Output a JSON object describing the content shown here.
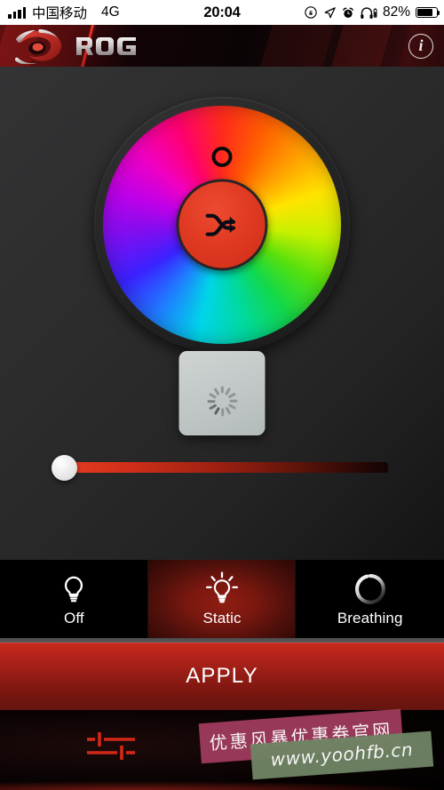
{
  "statusbar": {
    "carrier": "中国移动",
    "network": "4G",
    "time": "20:04",
    "battery_percent": "82%",
    "icons": [
      "signal-bars-icon",
      "rotation-lock-icon",
      "location-arrow-icon",
      "alarm-clock-icon",
      "headphones-battery-icon",
      "battery-icon"
    ]
  },
  "header": {
    "brand": "ROG",
    "logo_icon": "rog-eye-logo",
    "info_icon": "info-icon",
    "info_label": "i"
  },
  "main": {
    "color_wheel": {
      "name": "color-wheel",
      "selected_hue_deg": 0,
      "cursor_icon": "hue-selector-ring",
      "center_button_icon": "shuffle-icon",
      "center_button_color": "#e03a22"
    },
    "brightness_popup": {
      "name": "brightness-popup",
      "icon": "loading-spinner-icon",
      "background": "#c3c9c8"
    },
    "brightness_slider": {
      "name": "brightness-slider",
      "value_percent": 0,
      "track_start_color": "#e23a20",
      "track_end_color": "#140404",
      "thumb_color": "#ffffff"
    }
  },
  "modes": {
    "selected": "Static",
    "items": [
      {
        "label": "Off",
        "icon": "lightbulb-off-icon",
        "selected": false
      },
      {
        "label": "Static",
        "icon": "lightbulb-on-icon",
        "selected": true
      },
      {
        "label": "Breathing",
        "icon": "breathing-ring-icon",
        "selected": false
      }
    ]
  },
  "apply": {
    "label": "APPLY",
    "color": "#b2231a"
  },
  "bottomnav": {
    "items": [
      {
        "name": "settings-sliders",
        "icon": "sliders-icon",
        "color": "#d32818"
      }
    ]
  },
  "watermarks": [
    {
      "text": "优惠风暴优惠券官网",
      "color": "#9e3b5c"
    },
    {
      "text": "www.yoohfb.cn",
      "color": "#6f8364"
    }
  ]
}
